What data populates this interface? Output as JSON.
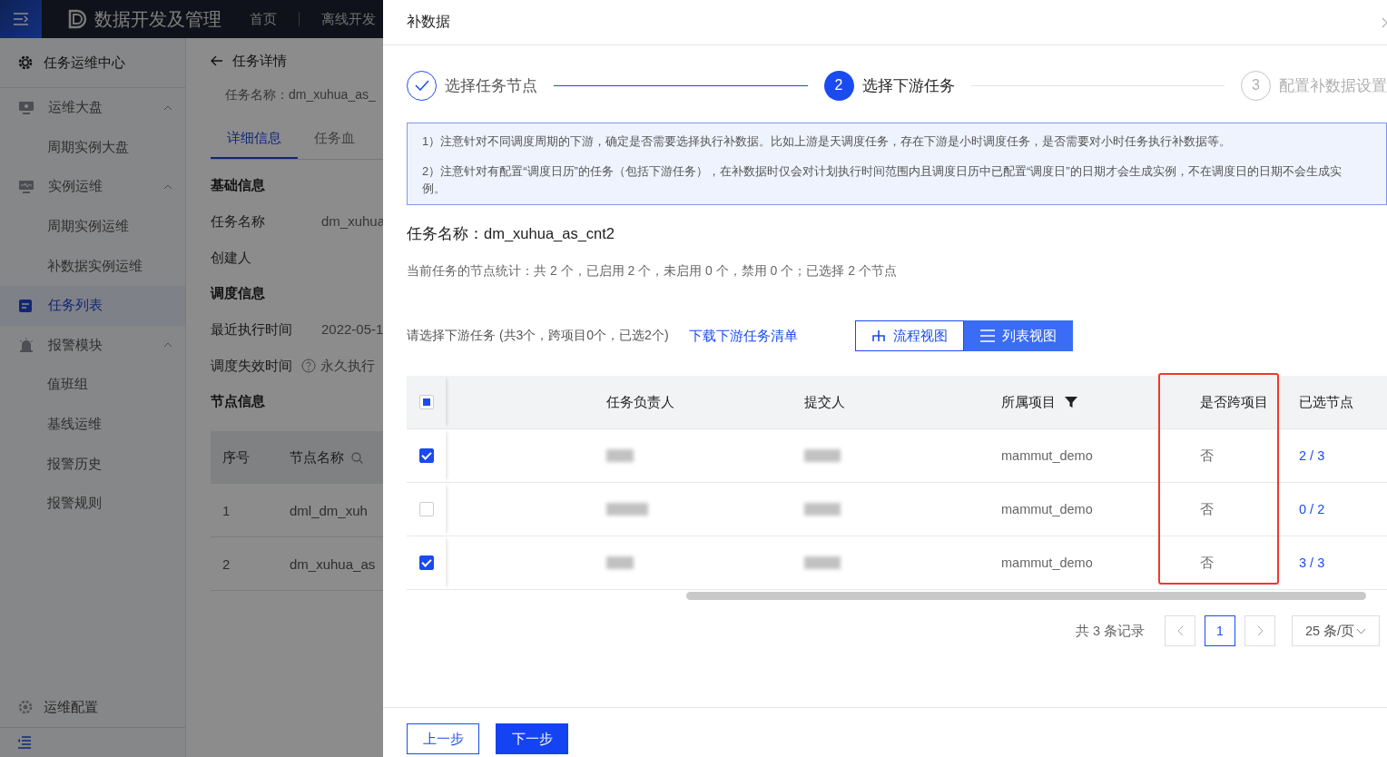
{
  "app": {
    "title": "数据开发及管理",
    "nav": [
      "首页",
      "离线开发"
    ]
  },
  "sidebar": {
    "header": "任务运维中心",
    "items": [
      {
        "label": "运维大盘",
        "selected": false,
        "expanded": true,
        "children": [
          {
            "label": "周期实例大盘",
            "selected": false
          }
        ]
      },
      {
        "label": "实例运维",
        "selected": false,
        "expanded": true,
        "children": [
          {
            "label": "周期实例运维",
            "selected": false
          },
          {
            "label": "补数据实例运维",
            "selected": false
          }
        ]
      },
      {
        "label": "任务列表",
        "selected": true
      },
      {
        "label": "报警模块",
        "selected": false,
        "expanded": true,
        "children": [
          {
            "label": "值班组",
            "selected": false
          },
          {
            "label": "基线运维",
            "selected": false
          },
          {
            "label": "报警历史",
            "selected": false
          },
          {
            "label": "报警规则",
            "selected": false
          }
        ]
      }
    ],
    "footer": "运维配置"
  },
  "detail": {
    "title": "任务详情",
    "task_name": "任务名称：dm_xuhua_as_",
    "tabs": [
      {
        "label": "详细信息",
        "selected": true
      },
      {
        "label": "任务血",
        "selected": false
      }
    ],
    "sections": [
      {
        "title": "基础信息",
        "fields": [
          {
            "label": "任务名称",
            "value": "dm_xuhua"
          },
          {
            "label": "创建人"
          }
        ]
      },
      {
        "title": "调度信息",
        "fields": [
          {
            "label": "最近执行时间",
            "value": "2022-05-1"
          },
          {
            "label": "调度失效时间",
            "value": "永久执行",
            "help": true
          }
        ]
      },
      {
        "title": "节点信息"
      }
    ],
    "node_table": {
      "columns": [
        "序号",
        "节点名称"
      ],
      "rows": [
        [
          "1",
          "dml_dm_xuh"
        ],
        [
          "2",
          "dm_xuhua_as"
        ]
      ]
    }
  },
  "drawer": {
    "title": "补数据",
    "steps": [
      {
        "label": "选择任务节点",
        "completed": true,
        "current": false
      },
      {
        "number": "2",
        "label": "选择下游任务",
        "completed": false,
        "current": true
      },
      {
        "number": "3",
        "label": "配置补数据设置",
        "completed": false,
        "current": false
      }
    ],
    "notices": [
      "1）注意针对不同调度周期的下游，确定是否需要选择执行补数据。比如上游是天调度任务，存在下游是小时调度任务，是否需要对小时任务执行补数据等。",
      "2）注意针对有配置“调度日历”的任务（包括下游任务），在补数据时仅会对计划执行时间范围内且调度日历中已配置“调度日”的日期才会生成实例，不在调度日的日期不会生成实例。"
    ],
    "task_name": "任务名称：dm_xuhua_as_cnt2",
    "stats": "当前任务的节点统计：共 2 个，已启用 2 个，未启用 0 个，禁用 0 个；已选择 2 个节点",
    "downstream_summary": "请选择下游任务 (共3个，跨项目0个，已选2个)",
    "download_link": "下载下游任务清单",
    "views": [
      {
        "label": "流程视图",
        "selected": false
      },
      {
        "label": "列表视图",
        "selected": true
      }
    ],
    "table": {
      "select_all": {
        "indeterminate": true
      },
      "columns": [
        {
          "label": "任务负责人"
        },
        {
          "label": "提交人"
        },
        {
          "label": "所属项目",
          "filter": true
        },
        {
          "label": "是否跨项目",
          "highlighted": true
        },
        {
          "label": "已选节点"
        }
      ],
      "rows": [
        {
          "checked": true,
          "project": "mammut_demo",
          "cross_project": "否",
          "selected_nodes": "2 / 3"
        },
        {
          "checked": false,
          "project": "mammut_demo",
          "cross_project": "否",
          "selected_nodes": "0 / 2"
        },
        {
          "checked": true,
          "project": "mammut_demo",
          "cross_project": "否",
          "selected_nodes": "3 / 3"
        }
      ]
    },
    "pagination": {
      "total": "共 3 条记录",
      "pages": [
        {
          "label": "1",
          "selected": true
        }
      ],
      "page_size": "25 条/页"
    },
    "buttons": [
      {
        "label": "上一步",
        "kind": "secondary"
      },
      {
        "label": "下一步",
        "kind": "primary"
      }
    ]
  }
}
